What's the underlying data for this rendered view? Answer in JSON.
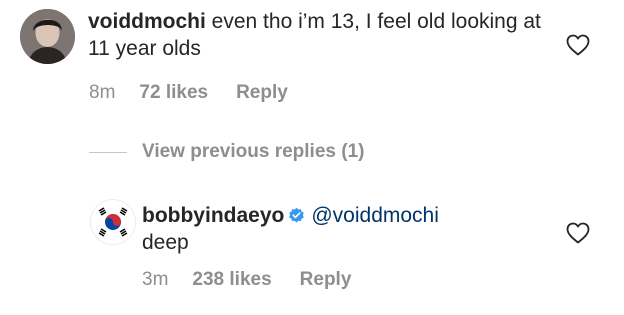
{
  "comment": {
    "username": "voiddmochi",
    "text": " even tho i’m 13, I feel old looking at 11 year olds",
    "time": "8m",
    "likes": "72 likes",
    "reply_label": "Reply",
    "avatar_icon": "profile-photo",
    "like_icon": "heart-outline-icon"
  },
  "view_previous_replies": "View previous replies (1)",
  "reply": {
    "username": "bobbyindaeyo",
    "verified_icon": "verified-badge-icon",
    "verified_color": "#3897f0",
    "mention": "@voiddmochi",
    "text": "deep",
    "time": "3m",
    "likes": "238 likes",
    "reply_label": "Reply",
    "avatar_icon": "south-korea-flag",
    "like_icon": "heart-outline-icon"
  },
  "colors": {
    "primary_text": "#262626",
    "secondary_text": "#8e8e8e",
    "mention": "#003569"
  }
}
